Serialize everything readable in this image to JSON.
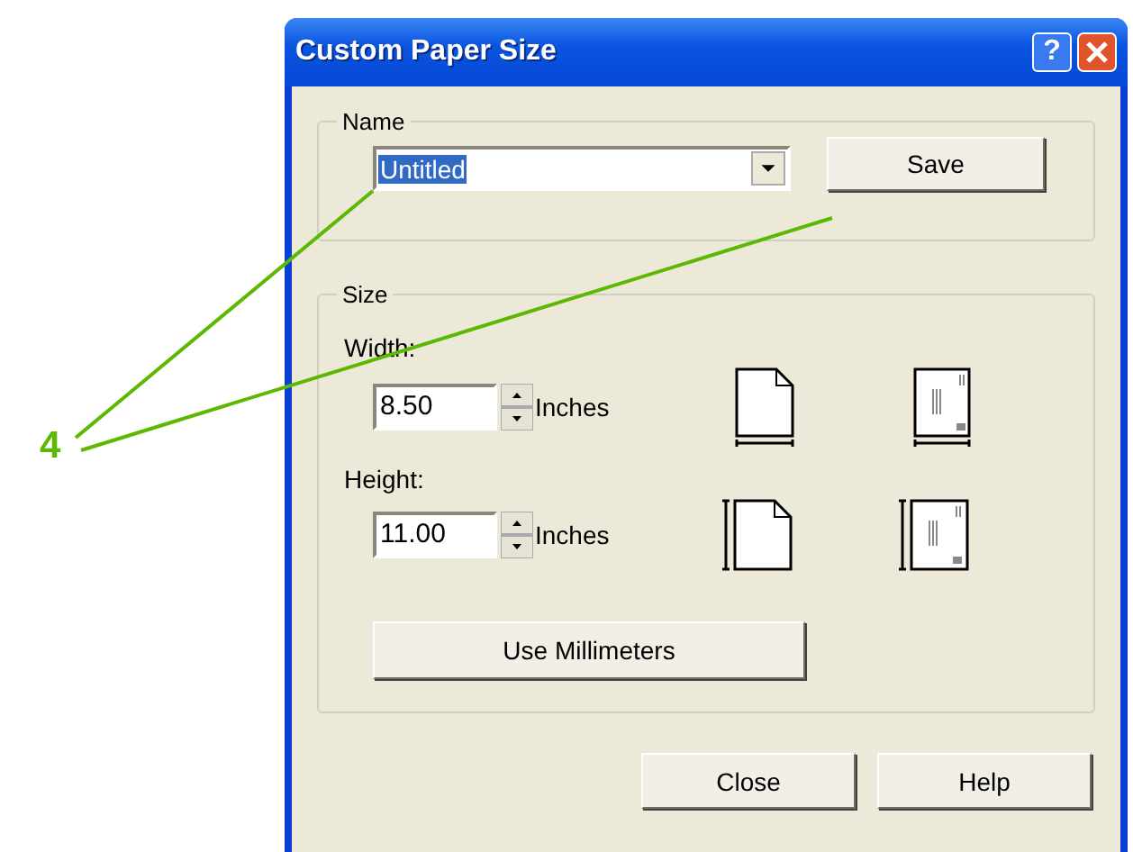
{
  "window": {
    "title": "Custom Paper Size",
    "help_glyph": "?"
  },
  "name_group": {
    "label": "Name",
    "value": "Untitled",
    "value_selected": true,
    "save": "Save"
  },
  "size_group": {
    "label": "Size",
    "fields": [
      {
        "label": "Width:",
        "value": "8.50",
        "unit": "Inches",
        "kind": "width"
      },
      {
        "label": "Height:",
        "value": "11.00",
        "unit": "Inches",
        "kind": "height"
      }
    ],
    "units_button": "Use Millimeters"
  },
  "buttons": [
    "Close",
    "Help"
  ],
  "callout": {
    "number": "4"
  }
}
